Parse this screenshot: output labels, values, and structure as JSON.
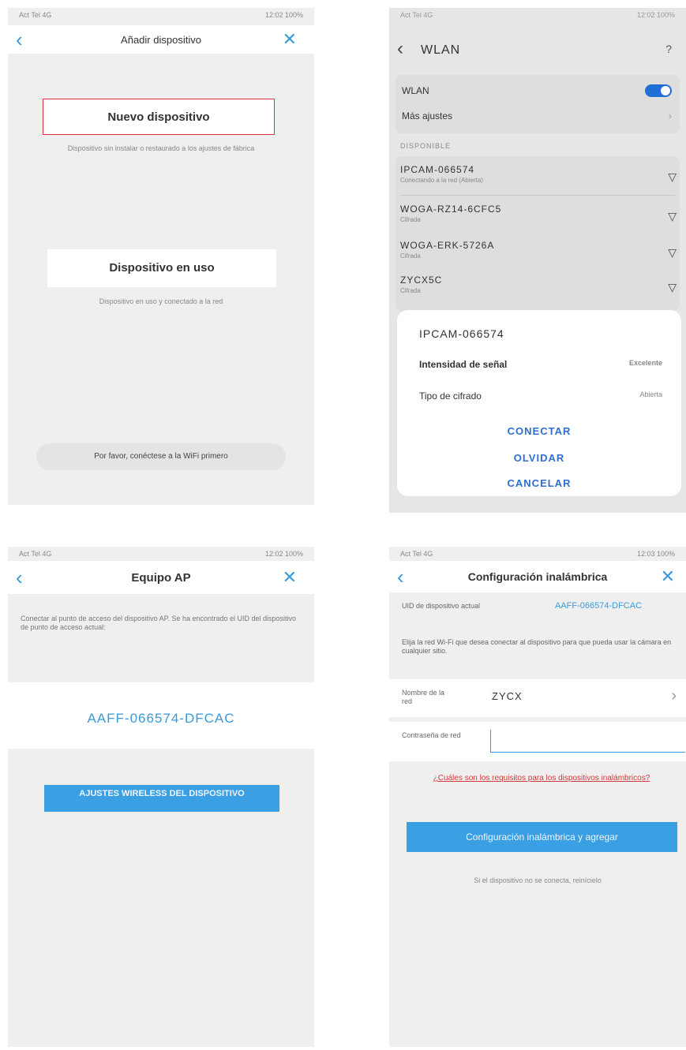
{
  "panel1": {
    "status_left": "Act Tel 4G",
    "status_right": "12:02 100%",
    "title": "Añadir dispositivo",
    "new_device_label": "Nuevo dispositivo",
    "new_device_desc": "Dispositivo sin instalar o restaurado a los ajustes de fábrica",
    "in_use_label": "Dispositivo en uso",
    "in_use_desc": "Dispositivo en uso y conectado a la red",
    "bottom_pill": "Por favor, conéctese a la WiFi primero"
  },
  "panel2": {
    "status_left": "Act Tel 4G",
    "status_right": "12:02 100%",
    "title": "WLAN",
    "help_icon": "?",
    "wlan_label": "WLAN",
    "wlan_on": true,
    "more_settings": "Más ajustes",
    "available_header": "DISPONIBLE",
    "networks": [
      {
        "name": "IPCAM-066574",
        "sub": "Conectando a la red (Abierta)"
      },
      {
        "name": "WOGA-RZ14-6CFC5",
        "sub": "Cifrada"
      },
      {
        "name": "WOGA-ERK-5726A",
        "sub": "Cifrada"
      },
      {
        "name": "ZYCX5C",
        "sub": "Cifrada"
      }
    ],
    "sheet": {
      "network_name": "IPCAM-066574",
      "signal_label": "Intensidad de señal",
      "signal_value": "Excelente",
      "security_label": "Tipo de cifrado",
      "security_value": "Abierta",
      "connect": "CONECTAR",
      "forget": "OLVIDAR",
      "cancel": "CANCELAR"
    }
  },
  "panel3": {
    "status_left": "Act Tel 4G",
    "status_right": "12:02 100%",
    "title": "Equipo AP",
    "note": "Conectar al punto de acceso del dispositivo AP. Se ha encontrado el UID del dispositivo de punto de acceso actual:",
    "uid": "AAFF-066574-DFCAC",
    "button_label": "AJUSTES WIRELESS DEL DISPOSITIVO"
  },
  "panel4": {
    "status_left": "Act Tel 4G",
    "status_right": "12:03 100%",
    "title": "Configuración inalámbrica",
    "uid_label": "UID de dispositivo actual",
    "uid_value": "AAFF-066574-DFCAC",
    "note": "Elija la red Wi-Fi que desea conectar al dispositivo para que pueda usar la cámara en cualquier sitio.",
    "network_name_label": "Nombre de la red",
    "network_name_value": "ZYCX",
    "password_label": "Contraseña de red",
    "password_value": "",
    "requirements_link": "¿Cuáles son los requisitos para los dispositivos inalámbricos?",
    "config_button": "Configuración inalámbrica y agregar",
    "hint": "Si el dispositivo no se conecta, reinícielo"
  }
}
